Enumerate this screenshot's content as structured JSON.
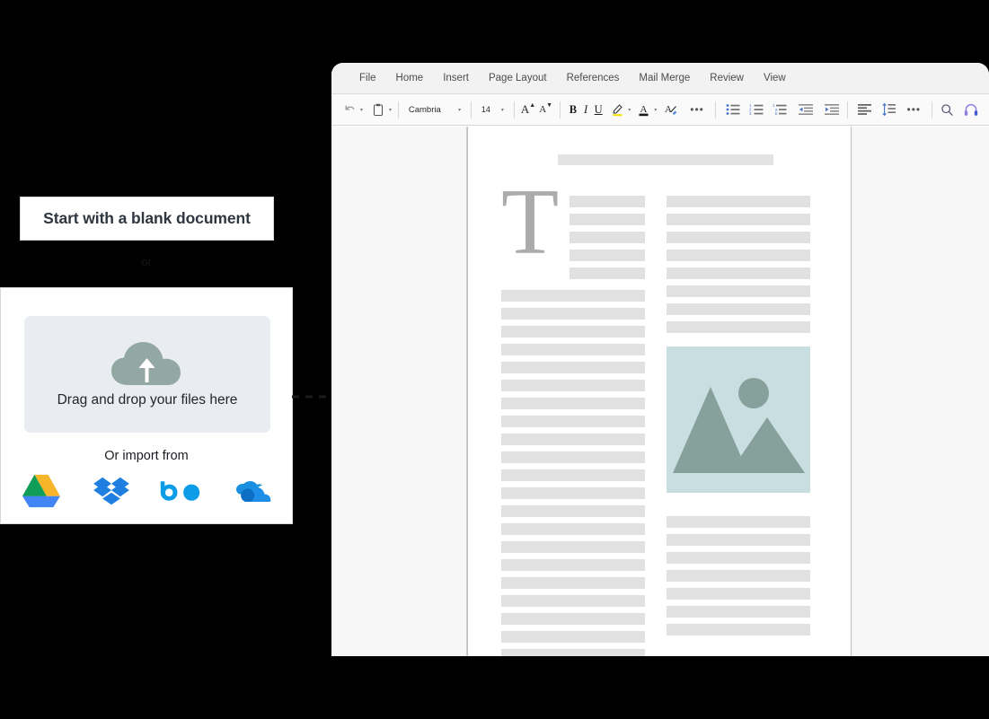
{
  "left_panel": {
    "blank_doc_label": "Start with a blank document",
    "or_label": "or",
    "dropzone_label": "Drag and drop your files here",
    "import_from_label": "Or import from",
    "cloud_icon": "cloud-upload-icon",
    "providers": [
      {
        "name": "google-drive",
        "label": "Google Drive"
      },
      {
        "name": "dropbox",
        "label": "Dropbox"
      },
      {
        "name": "box",
        "label": "Box"
      },
      {
        "name": "onedrive",
        "label": "OneDrive"
      }
    ]
  },
  "flow": {
    "arrow_name": "dashed-flow-arrow"
  },
  "editor": {
    "menu": [
      {
        "label": "File"
      },
      {
        "label": "Home"
      },
      {
        "label": "Insert"
      },
      {
        "label": "Page Layout"
      },
      {
        "label": "References"
      },
      {
        "label": "Mail Merge"
      },
      {
        "label": "Review"
      },
      {
        "label": "View"
      }
    ],
    "ribbon": {
      "undo_icon": "undo-icon",
      "paste_icon": "clipboard-paste-icon",
      "font_family": "Cambria",
      "font_size": "14",
      "grow_font_label": "A",
      "shrink_font_label": "A",
      "bold_label": "B",
      "italic_label": "I",
      "underline_label": "U",
      "highlight_icon": "text-highlight-icon",
      "font_color_icon": "font-color-icon",
      "clear_format_icon": "clear-formatting-icon",
      "more_font_label": "•••",
      "bullet_list_icon": "bullet-list-icon",
      "numbered_list_icon": "numbered-list-icon",
      "multilevel_list_icon": "multilevel-list-icon",
      "decrease_indent_icon": "decrease-indent-icon",
      "increase_indent_icon": "increase-indent-icon",
      "align_left_icon": "align-left-icon",
      "line_spacing_icon": "line-spacing-icon",
      "more_para_label": "•••",
      "search_icon": "search-icon",
      "read_aloud_icon": "read-aloud-headphones-icon",
      "highlight_color": "#f5e000",
      "font_color": "#1a1a1a",
      "accent_color": "#4472c4"
    },
    "document": {
      "dropcap_letter": "T",
      "image_placeholder": {
        "icon": "image-placeholder-icon",
        "bg_color": "#c8dee0",
        "shape_color": "#86a09b"
      },
      "left_column_head_lines": 5,
      "left_column_body_lines": 21,
      "right_column_top_lines": 8,
      "right_column_bottom_lines": 7
    }
  }
}
